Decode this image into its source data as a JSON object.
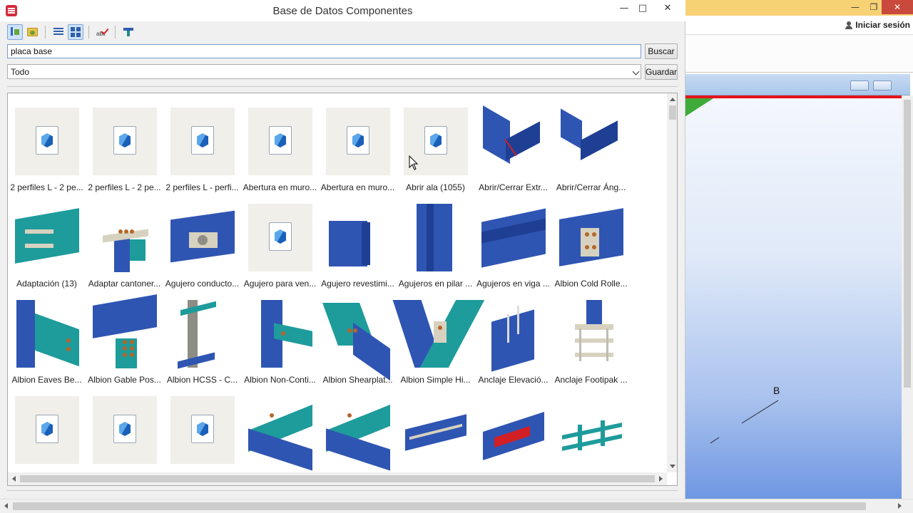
{
  "window": {
    "title": "Base de Datos Componentes",
    "minimize_glyph": "—",
    "maximize_glyph": "□",
    "close_glyph": "✕"
  },
  "toolbar": {
    "buttons": [
      "sort-icon",
      "folder-icon",
      "list-view-icon",
      "thumbnail-view-icon",
      "spellcheck-icon",
      "filter-icon"
    ]
  },
  "search": {
    "value": "placa base",
    "button_label": "Buscar"
  },
  "filter": {
    "selected": "Todo",
    "save_label": "Guardar"
  },
  "components": [
    {
      "label": "2 perfiles L - 2 pe...",
      "thumb": "placeholder"
    },
    {
      "label": "2 perfiles L - 2 pe...",
      "thumb": "placeholder"
    },
    {
      "label": "2 perfiles L - perfi...",
      "thumb": "placeholder"
    },
    {
      "label": "Abertura en muro...",
      "thumb": "placeholder"
    },
    {
      "label": "Abertura en muro...",
      "thumb": "placeholder"
    },
    {
      "label": "Abrir ala (1055)",
      "thumb": "placeholder"
    },
    {
      "label": "Abrir/Cerrar Extr...",
      "thumb": "angle-red"
    },
    {
      "label": "Abrir/Cerrar Áng...",
      "thumb": "angle-open"
    },
    {
      "label": "Adaptación (13)",
      "thumb": "beam-teal-plate"
    },
    {
      "label": "Adaptar cantoner...",
      "thumb": "column-cap"
    },
    {
      "label": "Agujero conducto...",
      "thumb": "beam-hole"
    },
    {
      "label": "Agujero para ven...",
      "thumb": "placeholder"
    },
    {
      "label": "Agujero revestimi...",
      "thumb": "box-section"
    },
    {
      "label": "Agujeros en pilar ...",
      "thumb": "column-holes"
    },
    {
      "label": "Agujeros en viga ...",
      "thumb": "beam-holes"
    },
    {
      "label": "Albion Cold Rolle...",
      "thumb": "beam-bolted"
    },
    {
      "label": "Albion Eaves Be...",
      "thumb": "eaves"
    },
    {
      "label": "Albion Gable Pos...",
      "thumb": "gable"
    },
    {
      "label": "Albion HCSS - C...",
      "thumb": "hcss"
    },
    {
      "label": "Albion Non-Conti...",
      "thumb": "non-cont"
    },
    {
      "label": "Albion Shearplat...",
      "thumb": "shearplate"
    },
    {
      "label": "Albion Simple Hi...",
      "thumb": "simple-hinge"
    },
    {
      "label": "Anclaje Elevació...",
      "thumb": "lifting"
    },
    {
      "label": "Anclaje Footipak ...",
      "thumb": "footipak"
    },
    {
      "label": "",
      "thumb": "placeholder"
    },
    {
      "label": "",
      "thumb": "placeholder"
    },
    {
      "label": "",
      "thumb": "placeholder"
    },
    {
      "label": "",
      "thumb": "teal-beam-1"
    },
    {
      "label": "",
      "thumb": "teal-beam-2"
    },
    {
      "label": "",
      "thumb": "beam-rod"
    },
    {
      "label": "",
      "thumb": "beam-red"
    },
    {
      "label": "",
      "thumb": "grid-frame"
    }
  ],
  "background_app": {
    "login_label": "Iniciar sesión",
    "viewport_label": "B",
    "titlebar_color": "#f6d275",
    "viewport_border_color": "#e3141c"
  },
  "colors": {
    "steel_blue": "#2f55b3",
    "steel_teal": "#1e9b9b",
    "accent_border": "#7a9cc9"
  }
}
